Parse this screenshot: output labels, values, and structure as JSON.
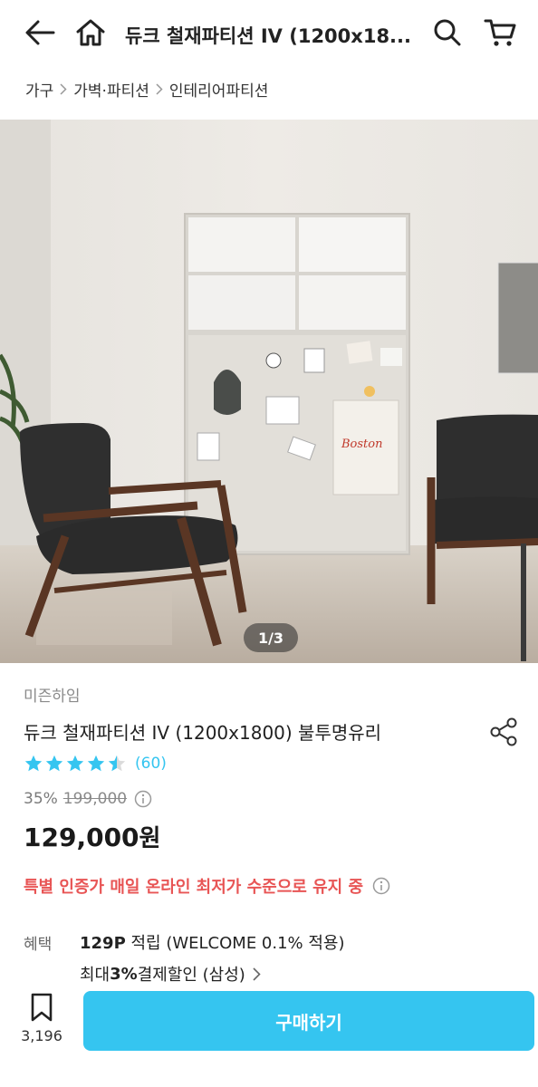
{
  "header": {
    "title": "듀크 철재파티션 IV (1200x18...",
    "back_icon": "arrow-left-icon",
    "home_icon": "home-icon",
    "search_icon": "search-icon",
    "cart_icon": "cart-icon"
  },
  "breadcrumb": [
    "가구",
    "가벽·파티션",
    "인테리어파티션"
  ],
  "gallery": {
    "counter": "1/3",
    "wall_sign_text": "Boston"
  },
  "product": {
    "brand": "미즌하임",
    "name": "듀크 철재파티션 IV (1200x1800) 불투명유리",
    "rating": 4.5,
    "review_count": "(60)",
    "discount": "35%",
    "original_price": "199,000",
    "price": "129,000",
    "price_unit": "원",
    "promo": "특별 인증가 매일 온라인 최저가 수준으로 유지 중"
  },
  "benefits": {
    "label": "혜택",
    "points": "129P",
    "points_text": " 적립 (WELCOME 0.1% 적용)",
    "card_prefix": "최대 ",
    "card_rate": "3%",
    "card_text": " 결제할인 (삼성)"
  },
  "bottom_bar": {
    "bookmark_count": "3,196",
    "buy_label": "구매하기"
  },
  "colors": {
    "accent": "#35c5f0",
    "promo": "#e85555",
    "muted": "#8a8a8a"
  }
}
